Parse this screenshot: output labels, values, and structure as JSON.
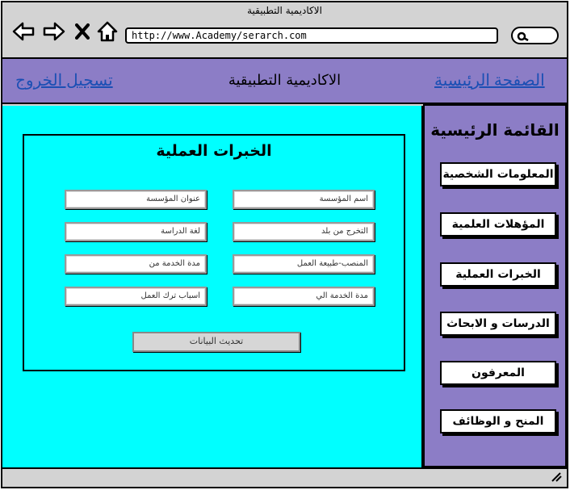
{
  "window": {
    "title": "الاكاديمية التطبيقية"
  },
  "browser": {
    "url": "http://www.Academy/serarch.com",
    "icons": [
      "back-arrow-icon",
      "forward-arrow-icon",
      "close-icon",
      "home-icon",
      "search-icon"
    ]
  },
  "header": {
    "home_link": "الصفحة الرئيسية",
    "title": "الاكاديمية التطبيقية",
    "logout_link": "تسجيل الخروج"
  },
  "form": {
    "title": "الخبرات العملية",
    "fields": {
      "institution_name": "اسم المؤسسة",
      "institution_address": "عنوان المؤسسة",
      "graduation_country": "التخرج من بلد",
      "study_language": "لغة الدراسة",
      "position": "المنصب-طبيعة العمل",
      "service_from": "مدة الخدمة من",
      "service_to": "مدة الخدمة الي",
      "leaving_reasons": "اسباب ترك العمل"
    },
    "update_button": "تحديث البيانات"
  },
  "sidebar": {
    "title": "القائمة الرئيسية",
    "items": [
      {
        "label": "المعلومات الشخصية"
      },
      {
        "label": "المؤهلات العلمية"
      },
      {
        "label": "الخبرات العملية"
      },
      {
        "label": "الدرسات و الابحاث"
      },
      {
        "label": "المعرفون"
      },
      {
        "label": "المنح و الوظائف"
      }
    ]
  },
  "colors": {
    "chrome": "#d3d3d3",
    "header": "#8c7dc6",
    "content": "#00ffff",
    "link": "#1b4fb4"
  }
}
